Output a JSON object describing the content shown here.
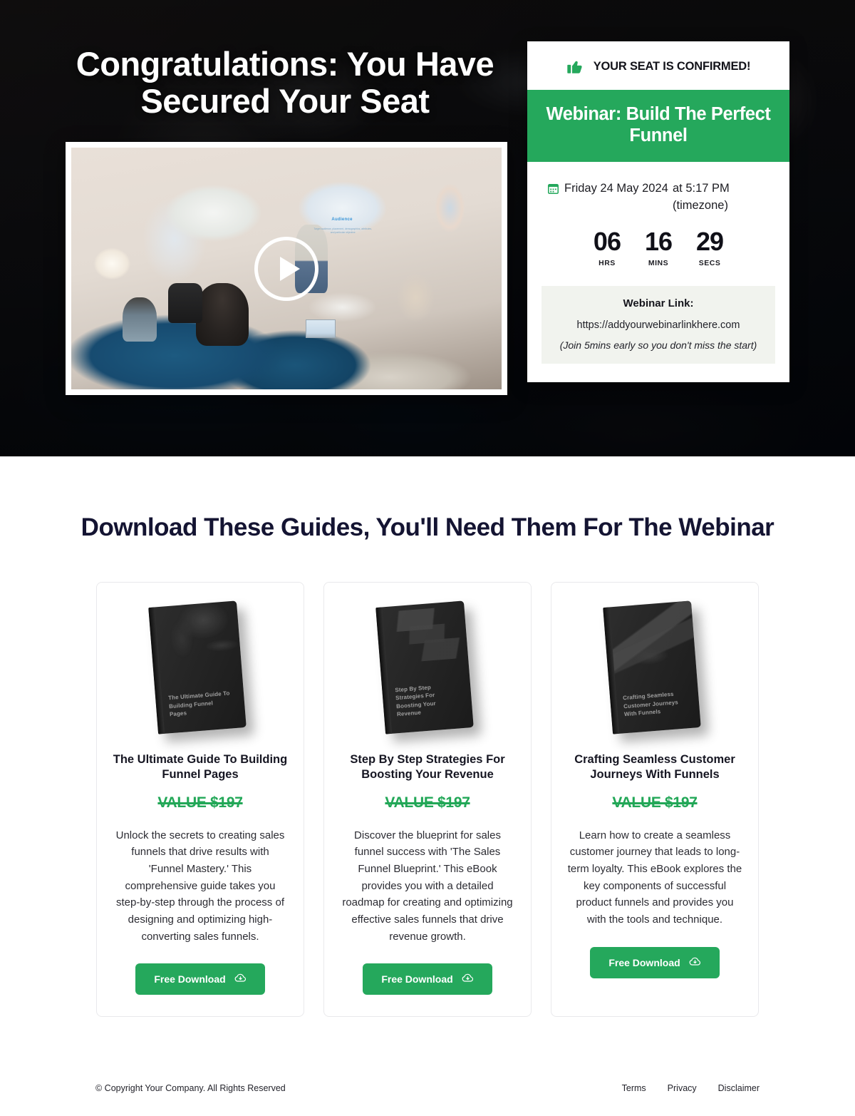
{
  "hero": {
    "headline": "Congratulations: You Have Secured Your Seat",
    "video": {
      "play_icon": "play-icon",
      "slide_title": "Audience",
      "slide_subtitle": "Target audience, placement, demographics, attributes, and particular objective"
    }
  },
  "confirm_card": {
    "thumb_icon": "thumbs-up-icon",
    "confirmed_text": "YOUR SEAT IS CONFIRMED!",
    "banner_text": "Webinar: Build The Perfect Funnel",
    "calendar_icon": "calendar-icon",
    "date": "Friday 24 May 2024",
    "time": "at 5:17 PM (timezone)",
    "countdown": [
      {
        "value": "06",
        "label": "HRS"
      },
      {
        "value": "16",
        "label": "MINS"
      },
      {
        "value": "29",
        "label": "SECS"
      }
    ],
    "link_title": "Webinar Link:",
    "link_url": "https://addyourwebinarlinkhere.com",
    "link_note": "(Join 5mins early so you don't miss the start)"
  },
  "guides": {
    "title": "Download These Guides, You'll Need Them For The Webinar",
    "cards": [
      {
        "book_cover_text": "The Ultimate Guide To Building Funnel Pages",
        "title": "The Ultimate Guide To Building Funnel Pages",
        "value": "VALUE $197",
        "description": "Unlock the secrets to creating sales funnels that drive results with 'Funnel Mastery.' This comprehensive guide takes you step-by-step through the process of designing and optimizing high-converting sales funnels.",
        "button_label": "Free Download",
        "button_icon": "cloud-download-icon"
      },
      {
        "book_cover_text": "Step By Step Strategies For Boosting Your Revenue",
        "title": "Step By Step Strategies For Boosting Your Revenue",
        "value": "VALUE $197",
        "description": "Discover the blueprint for sales funnel success with 'The Sales Funnel Blueprint.' This eBook provides you with a detailed roadmap for creating and optimizing effective sales funnels that drive revenue growth.",
        "button_label": "Free Download",
        "button_icon": "cloud-download-icon"
      },
      {
        "book_cover_text": "Crafting Seamless Customer Journeys With Funnels",
        "title": "Crafting Seamless Customer Journeys With Funnels",
        "value": "VALUE $197",
        "description": "Learn how to create a seamless customer journey that leads to long-term loyalty. This eBook explores the key components of successful product funnels and provides you with the tools and technique.",
        "button_label": "Free Download",
        "button_icon": "cloud-download-icon"
      }
    ]
  },
  "footer": {
    "copyright": "© Copyright Your Company.  All Rights Reserved",
    "links": [
      {
        "label": "Terms"
      },
      {
        "label": "Privacy"
      },
      {
        "label": "Disclaimer"
      }
    ]
  },
  "colors": {
    "brand_green": "#25a85c",
    "value_green": "#22a757",
    "heading_navy": "#141432",
    "link_box_bg": "#f1f3ee"
  }
}
